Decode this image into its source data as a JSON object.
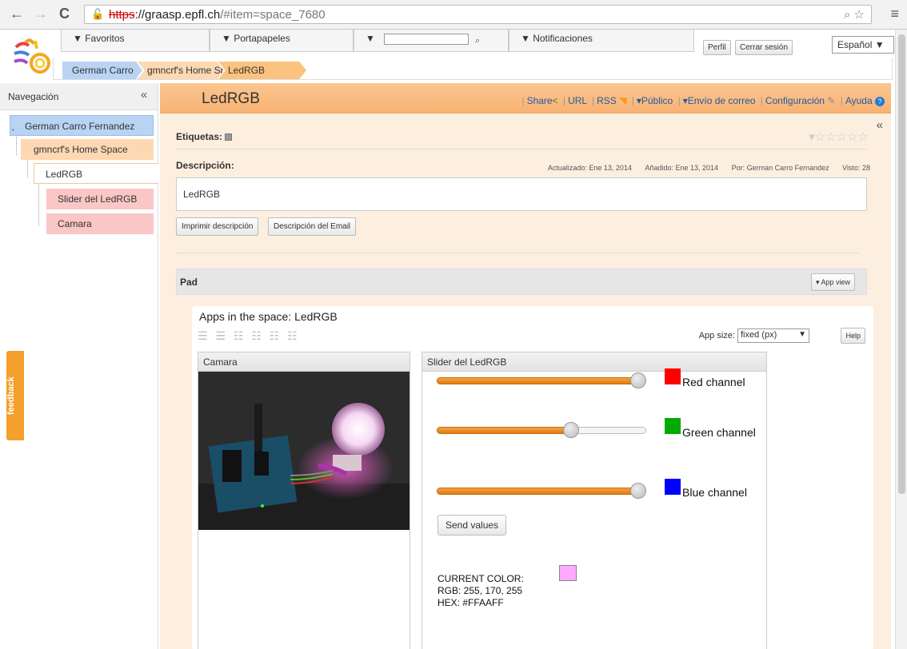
{
  "browser": {
    "url_protocol": "https",
    "url_host": "://graasp.epfl.ch",
    "url_path": "/#item=space_7680"
  },
  "header": {
    "tabs": [
      "▼ Favoritos",
      "▼ Portapapeles",
      "▼",
      "▼ Notificaciones"
    ],
    "profile_label": "Perfil",
    "logout_label": "Cerrar sesión",
    "language": "Español ▼",
    "breadcrumbs": [
      "German Carro",
      "gmncrf's Home Space",
      "LedRGB"
    ]
  },
  "sidebar": {
    "title": "Navegación",
    "items": [
      "German Carro Fernandez",
      "gmncrf's Home Space",
      "LedRGB",
      "Slider del LedRGB",
      "Camara"
    ],
    "feedback": "feedback"
  },
  "main": {
    "title": "LedRGB",
    "links": [
      "Share",
      "URL",
      "RSS",
      "▾Público",
      "▾Envío de correo",
      "Configuración",
      "Ayuda"
    ],
    "tags_label": "Etiquetas:",
    "description_label": "Descripción:",
    "meta": {
      "updated": "Actualizado:  Ene 13, 2014",
      "added": "Añadido:  Ene 13, 2014",
      "by": "Por:  German Carro Fernandez",
      "views": "Visto:  28"
    },
    "description": "LedRGB",
    "print_button": "Imprimir descripción",
    "email_button": "Descripción del Email",
    "pad_label": "Pad",
    "app_view_button": "▾ App view"
  },
  "apps": {
    "title": "Apps in the space: LedRGB",
    "app_size_label": "App size:",
    "app_size_value": "fixed (px)",
    "help": "Help",
    "camera_title": "Camara",
    "slider_title": "Slider del LedRGB",
    "channels": [
      {
        "label": "Red channel",
        "value": 255,
        "max": 255,
        "color": "#ff0000"
      },
      {
        "label": "Green channel",
        "value": 170,
        "max": 255,
        "color": "#00aa00"
      },
      {
        "label": "Blue channel",
        "value": 255,
        "max": 255,
        "color": "#0000ff"
      }
    ],
    "send_button": "Send values",
    "current_color_label": "CURRENT COLOR:",
    "rgb_text": "RGB: 255, 170, 255",
    "hex_text": "HEX: #FFAAFF",
    "current_color": "#ffaaff"
  }
}
